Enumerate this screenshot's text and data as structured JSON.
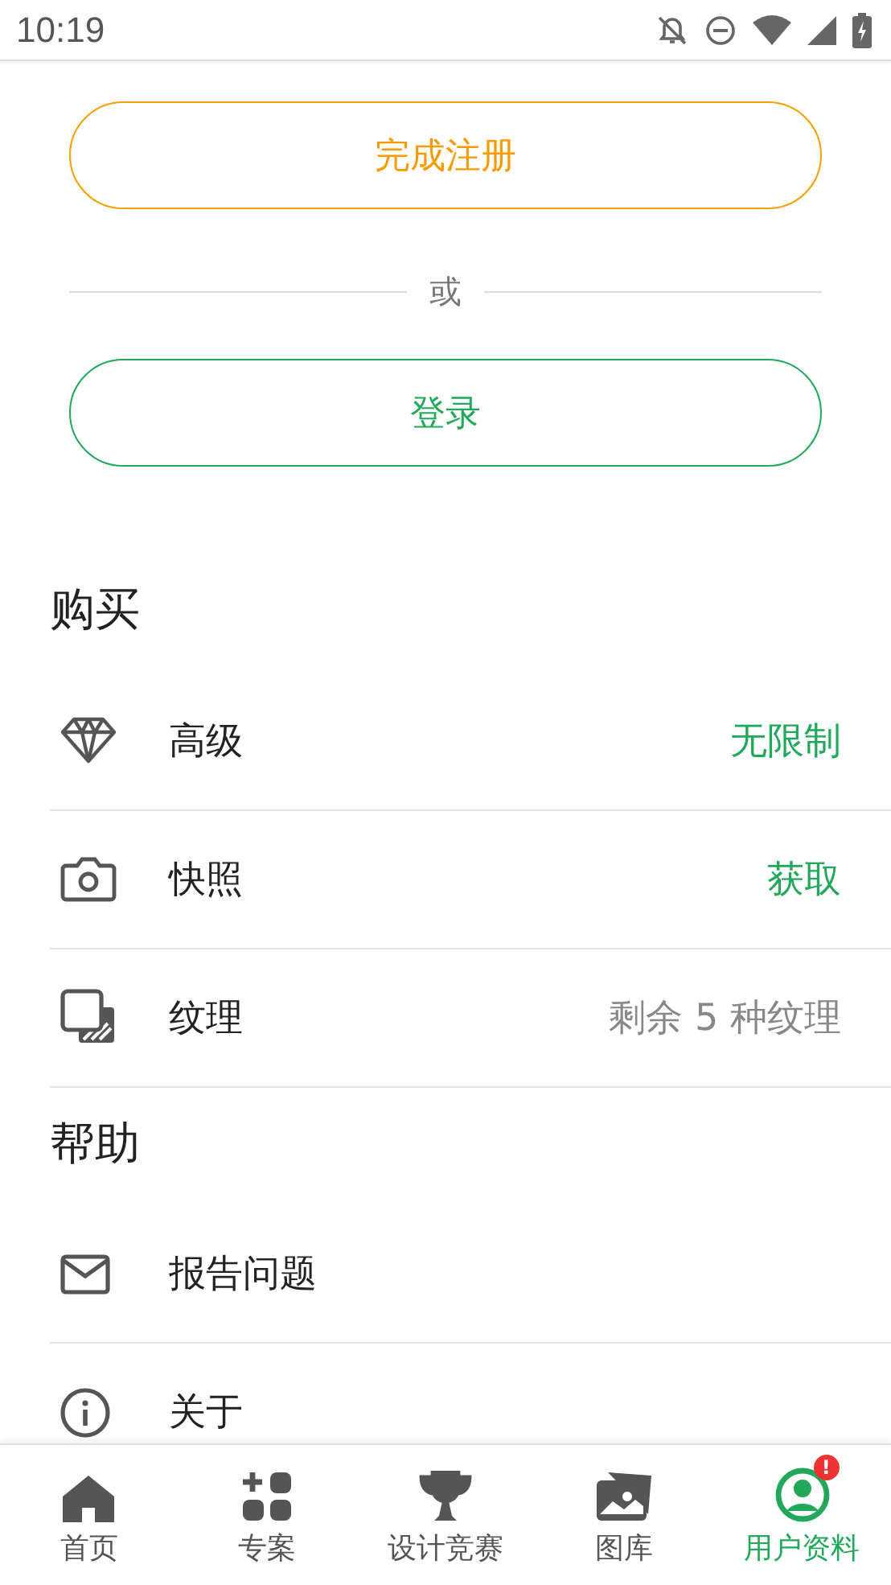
{
  "status_bar": {
    "time": "10:19"
  },
  "register_button": "完成注册",
  "divider_text": "或",
  "login_button": "登录",
  "sections": [
    {
      "title": "购买",
      "rows": [
        {
          "label": "高级",
          "value": "无限制",
          "kind": "link"
        },
        {
          "label": "快照",
          "value": "获取",
          "kind": "link"
        },
        {
          "label": "纹理",
          "value": "剩余 5 种纹理",
          "kind": "text"
        }
      ]
    },
    {
      "title": "帮助",
      "rows": [
        {
          "label": "报告问题"
        },
        {
          "label": "关于"
        }
      ]
    }
  ],
  "nav": [
    {
      "label": "首页",
      "selected": false
    },
    {
      "label": "专案",
      "selected": false
    },
    {
      "label": "设计竞赛",
      "selected": false
    },
    {
      "label": "图库",
      "selected": false
    },
    {
      "label": "用户资料",
      "selected": true,
      "badge": "!"
    }
  ]
}
